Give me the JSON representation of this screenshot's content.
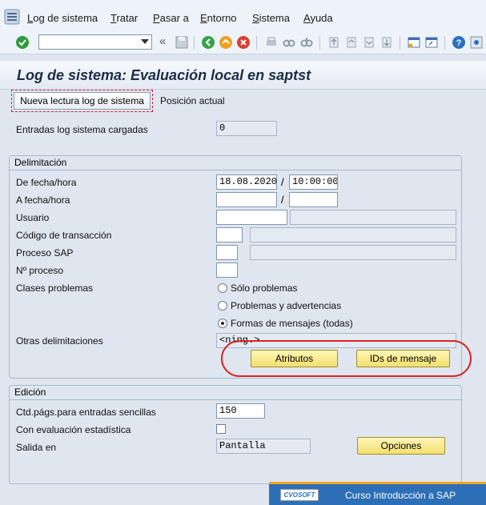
{
  "menu": {
    "items": [
      "Log de sistema",
      "Tratar",
      "Pasar a",
      "Entorno",
      "Sistema",
      "Ayuda"
    ]
  },
  "toolbar": {
    "command_value": "",
    "icons": [
      "enter-icon",
      "save-icon",
      "back-icon",
      "exit-icon",
      "cancel-icon",
      "print-icon",
      "find-icon",
      "find-next-icon",
      "first-page-icon",
      "prev-page-icon",
      "next-page-icon",
      "last-page-icon",
      "create-session-icon",
      "shortcut-icon",
      "help-icon",
      "customize-icon"
    ]
  },
  "title": "Log de sistema: Evaluación local en saptst",
  "app_toolbar": {
    "reread_label": "Nueva lectura log de sistema",
    "position_label": "Posición actual"
  },
  "entries": {
    "label": "Entradas log sistema cargadas",
    "value": "0"
  },
  "delimitation": {
    "title": "Delimitación",
    "from_label": "De fecha/hora",
    "from_date": "18.08.2020",
    "from_time": "10:00:00",
    "to_label": "A fecha/hora",
    "to_date": "",
    "to_time": "",
    "slash": "/",
    "user_label": "Usuario",
    "user_value": "",
    "tcode_label": "Código de transacción",
    "tcode_value": "",
    "process_label": "Proceso SAP",
    "process_value": "",
    "procno_label": "Nº proceso",
    "procno_value": "",
    "problems_label": "Clases problemas",
    "radio_only": "Sólo problemas",
    "radio_warnings": "Problemas y advertencias",
    "radio_all": "Formas de mensajes (todas)",
    "selected_radio": "radio_all",
    "other_label": "Otras delimitaciones",
    "other_value": "<ning.>",
    "attributes_button": "Atributos",
    "message_ids_button": "IDs de mensaje"
  },
  "edition": {
    "title": "Edición",
    "pages_label": "Ctd.págs.para entradas sencillas",
    "pages_value": "150",
    "stat_label": "Con evaluación estadística",
    "stat_checked": false,
    "output_label": "Salida en",
    "output_value": "Pantalla",
    "options_button": "Opciones"
  },
  "banner": {
    "logo_text": "CVOSOFT",
    "text": "Curso Introducción a SAP"
  },
  "colors": {
    "accent": "#2d6fb6",
    "highlight": "#d62525",
    "button_yellow": "#f2df6e"
  }
}
